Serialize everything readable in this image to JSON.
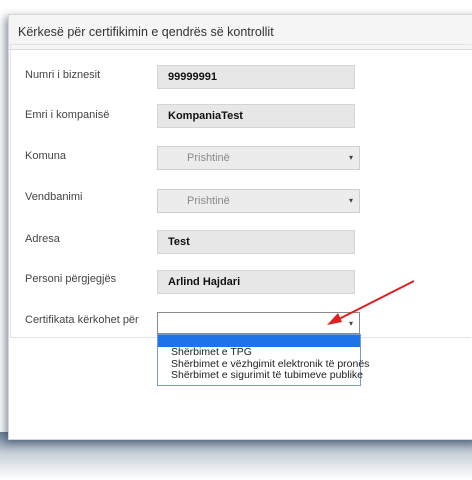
{
  "panel": {
    "title": "Kërkesë për certifikimin e qendrës së kontrollit"
  },
  "fields": [
    {
      "label": "Numri i biznesit",
      "value": "99999991"
    },
    {
      "label": "Emri i kompanisë",
      "value": "KompaniaTest"
    },
    {
      "label": "Komuna",
      "value": "Prishtinë"
    },
    {
      "label": "Vendbanimi",
      "value": "Prishtinë"
    },
    {
      "label": "Adresa",
      "value": "Test"
    },
    {
      "label": "Personi përgjegjës",
      "value": "Arlind Hajdari"
    },
    {
      "label": "Certifikata kërkohet për",
      "value": ""
    }
  ],
  "dropdown": {
    "options": [
      "",
      "Shërbimet e TPG",
      "Shërbimet e vëzhgimit elektronik të pronës",
      "Shërbimet e sigurimit të tubimeve publike"
    ],
    "highlighted_index": 0
  },
  "arrow_glyph": "▾",
  "colors": {
    "highlight": "#1e73e8",
    "annotation_arrow": "#e02020",
    "field_bg": "#e7e7e7"
  }
}
